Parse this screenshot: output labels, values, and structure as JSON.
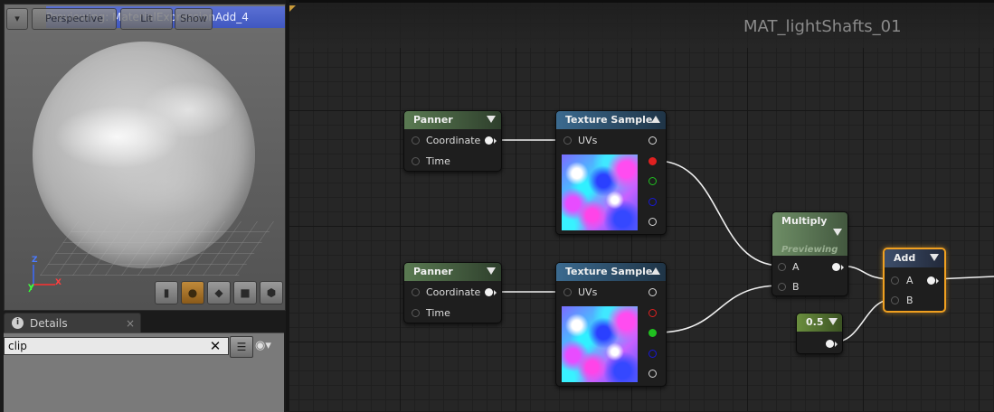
{
  "viewport": {
    "title": "Previewing: MaterialExpressionAdd_4",
    "buttons": {
      "perspective": "Perspective",
      "lit": "Lit",
      "show": "Show"
    },
    "axes": {
      "x": "X",
      "y": "Y",
      "z": "Z"
    },
    "tools": [
      "cylinder-icon",
      "sphere-icon",
      "plane-icon",
      "cube-icon",
      "mesh-icon"
    ]
  },
  "details": {
    "tab_label": "Details",
    "tab_close": "×",
    "search_value": "clip",
    "clear_glyph": "✕"
  },
  "graph": {
    "title": "MAT_lightShafts_01",
    "nodes": {
      "panner1": {
        "title": "Panner",
        "pins": [
          "Coordinate",
          "Time"
        ]
      },
      "panner2": {
        "title": "Panner",
        "pins": [
          "Coordinate",
          "Time"
        ]
      },
      "tex1": {
        "title": "Texture Sample",
        "input": "UVs"
      },
      "tex2": {
        "title": "Texture Sample",
        "input": "UVs"
      },
      "multiply": {
        "title": "Multiply",
        "status": "Previewing",
        "pins": [
          "A",
          "B"
        ]
      },
      "add": {
        "title": "Add",
        "pins": [
          "A",
          "B"
        ]
      },
      "constant": {
        "value": "0.5"
      }
    },
    "colors": {
      "red_pin": "#e02020",
      "green_pin": "#20c020",
      "blue_pin": "#1818d8",
      "selected_outline": "#f0a020"
    }
  }
}
